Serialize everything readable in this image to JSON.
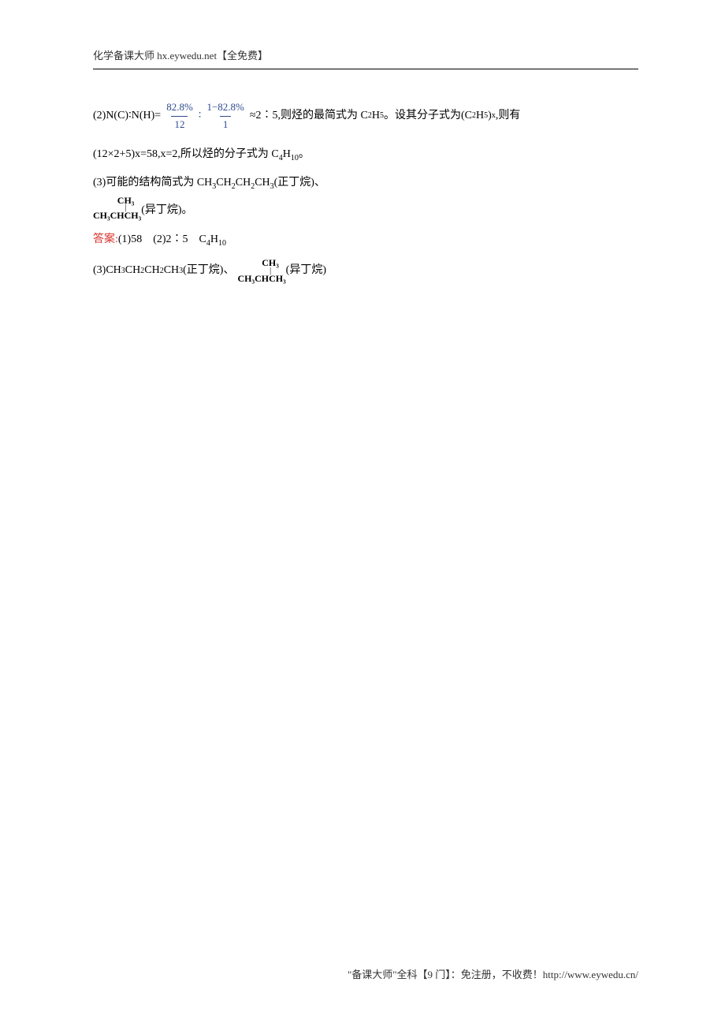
{
  "header": {
    "text": "化学备课大师 hx.eywedu.net【全免费】"
  },
  "body": {
    "line2_prefix": "(2)N(C)∶N(H)=",
    "frac1_num": "82.8%",
    "frac1_den": "12",
    "colon": "∶",
    "frac2_num": "1−82.8%",
    "frac2_den": "1",
    "line2_mid1": "≈2∶5,则烃的最简式为 C",
    "line2_sub1": "2",
    "line2_mid2": "H",
    "line2_sub2": "5",
    "line2_mid3": "。设其分子式为(C",
    "line2_sub3": "2",
    "line2_mid4": "H",
    "line2_sub4": "5",
    "line2_mid5": ")",
    "line2_sub5": "x",
    "line2_suffix": ",则有",
    "line3_a": "(12×2+5)x=58,x=2,所以烃的分子式为 C",
    "line3_sub1": "4",
    "line3_b": "H",
    "line3_sub2": "10",
    "line3_c": "。",
    "line4_a": "(3)可能的结构简式为 CH",
    "line4_sub1": "3",
    "line4_b": "CH",
    "line4_sub2": "2",
    "line4_c": "CH",
    "line4_sub3": "2",
    "line4_d": "CH",
    "line4_sub4": "3",
    "line4_e": "(正丁烷)、",
    "iso_top": "CH₃",
    "iso_bar": "|",
    "iso_bot": "CH₃CHCH₃",
    "line5_suffix": "(异丁烷)。",
    "answer_label": "答案:",
    "ans1": "(1)58　(2)2∶5　C",
    "ans1_sub1": "4",
    "ans1_h": "H",
    "ans1_sub2": "10",
    "ans3_a": "(3)CH",
    "ans3_sub1": "3",
    "ans3_b": "CH",
    "ans3_sub2": "2",
    "ans3_c": "CH",
    "ans3_sub3": "2",
    "ans3_d": "CH",
    "ans3_sub4": "3",
    "ans3_e": "(正丁烷)、",
    "ans3_suffix": "(异丁烷)"
  },
  "footer": {
    "text": "\"备课大师\"全科【9 门】：免注册，不收费！http://www.eywedu.cn/"
  }
}
